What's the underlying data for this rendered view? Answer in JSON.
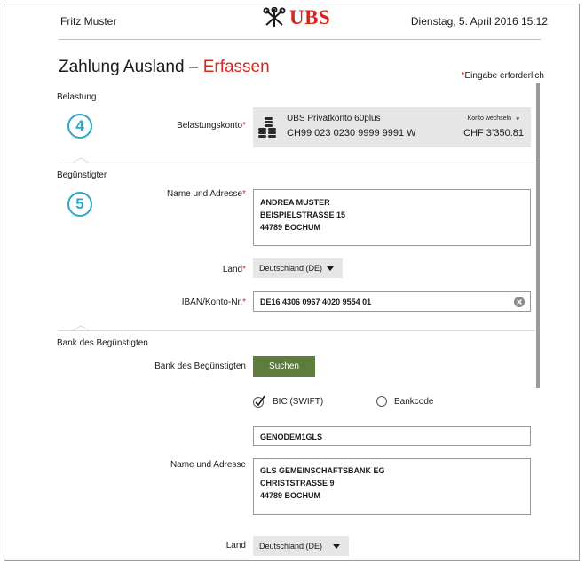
{
  "header": {
    "user_name": "Fritz Muster",
    "brand": "UBS",
    "datetime": "Dienstag, 5. April 2016 15:12"
  },
  "page": {
    "title_main": "Zahlung Ausland –",
    "title_accent": "Erfassen",
    "required_marker": "*",
    "required_note": "Eingabe erforderlich"
  },
  "belastung": {
    "section_label": "Belastung",
    "step_number": "4",
    "account_label": "Belastungskonto",
    "account_name": "UBS Privatkonto 60plus",
    "account_iban": "CH99 023 0230 9999 9991 W",
    "change_label": "Konto wechseln",
    "balance": "CHF 3’350.81"
  },
  "beguenstigter": {
    "section_label": "Begünstigter",
    "step_number": "5",
    "name_label": "Name und Adresse",
    "address_lines": [
      "ANDREA MUSTER",
      "BEISPIELSTRASSE 15",
      "44789 BOCHUM"
    ],
    "country_label": "Land",
    "country_value": "Deutschland (DE)",
    "iban_label": "IBAN/Konto-Nr.",
    "iban_value": "DE16 4306 0967 4020 9554 01"
  },
  "bank": {
    "section_label": "Bank des Begünstigten",
    "bank_label": "Bank des Begünstigten",
    "search_button": "Suchen",
    "option_bic": "BIC (SWIFT)",
    "option_bankcode": "Bankcode",
    "bic_value": "GENODEM1GLS",
    "name_label": "Name und Adresse",
    "address_lines": [
      "GLS GEMEINSCHAFTSBANK EG",
      "CHRISTSTRASSE 9",
      "44789 BOCHUM"
    ],
    "country_label": "Land",
    "country_value": "Deutschland (DE)"
  },
  "colors": {
    "brand_red": "#d7271d",
    "step_blue": "#2aa8c9",
    "button_green": "#5d7d3a"
  }
}
